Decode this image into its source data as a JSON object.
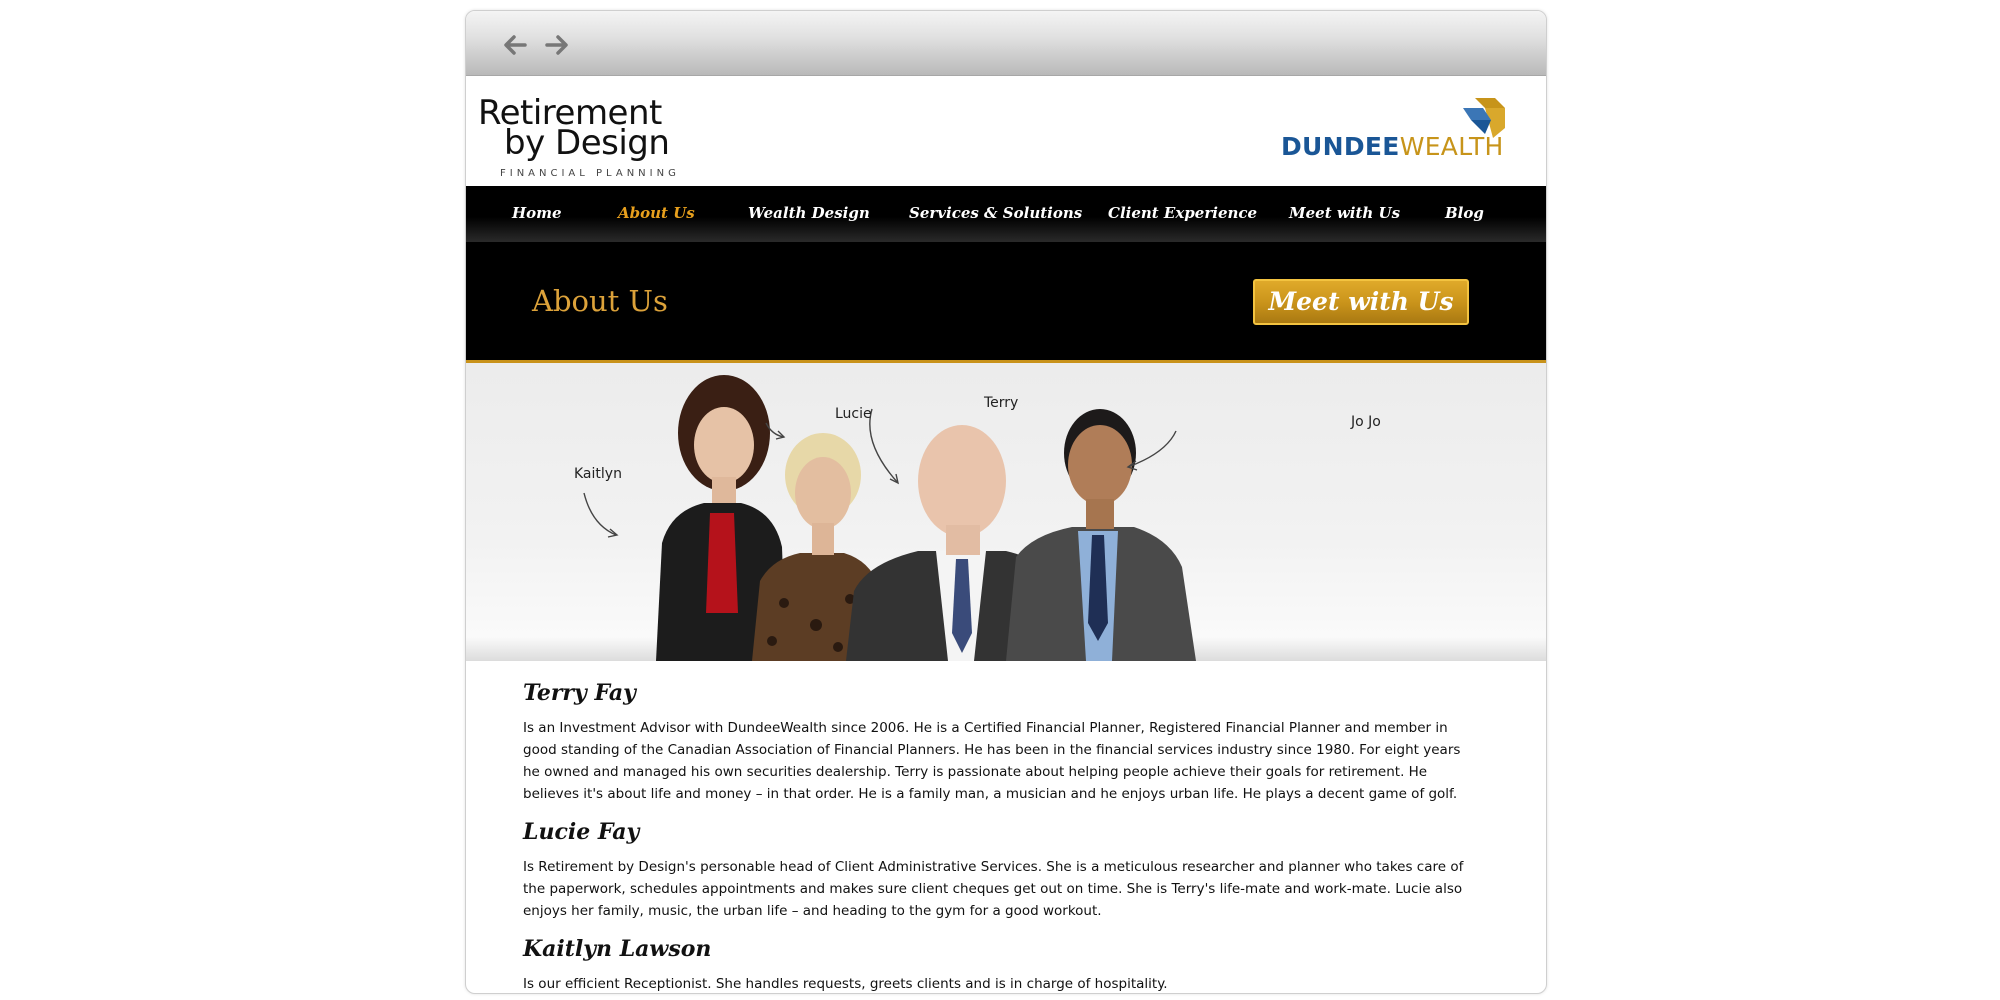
{
  "browser": {
    "back_icon": "left-arrow-icon",
    "forward_icon": "right-arrow-icon"
  },
  "header": {
    "logo_line1": "Retirement",
    "logo_line2": "by Design",
    "logo_sub": "FINANCIAL PLANNING",
    "partner_dundee": "DUNDEE",
    "partner_wealth": "WEALTH"
  },
  "nav": {
    "items": [
      {
        "label": "Home"
      },
      {
        "label": "About Us",
        "active": true
      },
      {
        "label": "Wealth Design"
      },
      {
        "label": "Services & Solutions"
      },
      {
        "label": "Client Experience"
      },
      {
        "label": "Meet with Us"
      },
      {
        "label": "Blog"
      }
    ]
  },
  "hero": {
    "title": "About Us",
    "cta_label": "Meet with Us"
  },
  "photo": {
    "labels": [
      "Kaitlyn",
      "Lucie",
      "Terry",
      "Jo Jo"
    ]
  },
  "team": [
    {
      "name": "Terry Fay",
      "bio": "Is an Investment Advisor with DundeeWealth since 2006. He is a Certified Financial Planner, Registered Financial Planner and member in good standing of the Canadian Association of Financial Planners. He has been in the financial services industry since 1980. For eight years he owned and managed his own securities dealership. Terry is passionate about helping people achieve their goals for retirement. He believes it's about life and money – in that order. He is a family man, a musician and he enjoys urban life. He plays a decent game of golf."
    },
    {
      "name": "Lucie Fay",
      "bio": "Is Retirement by Design's personable head of Client Administrative Services. She is a meticulous researcher and planner who takes care of the paperwork, schedules appointments and makes sure client cheques get out on time. She is Terry's life-mate and work-mate. Lucie also enjoys her family, music, the urban life – and heading to the gym for a good workout."
    },
    {
      "name": "Kaitlyn Lawson",
      "bio": "Is our efficient Receptionist. She handles requests, greets clients and is in charge of hospitality."
    }
  ],
  "colors": {
    "accent_gold": "#c8921a",
    "nav_active": "#e8a01d",
    "title_gold": "#dca23a",
    "brand_blue": "#1a5696"
  }
}
